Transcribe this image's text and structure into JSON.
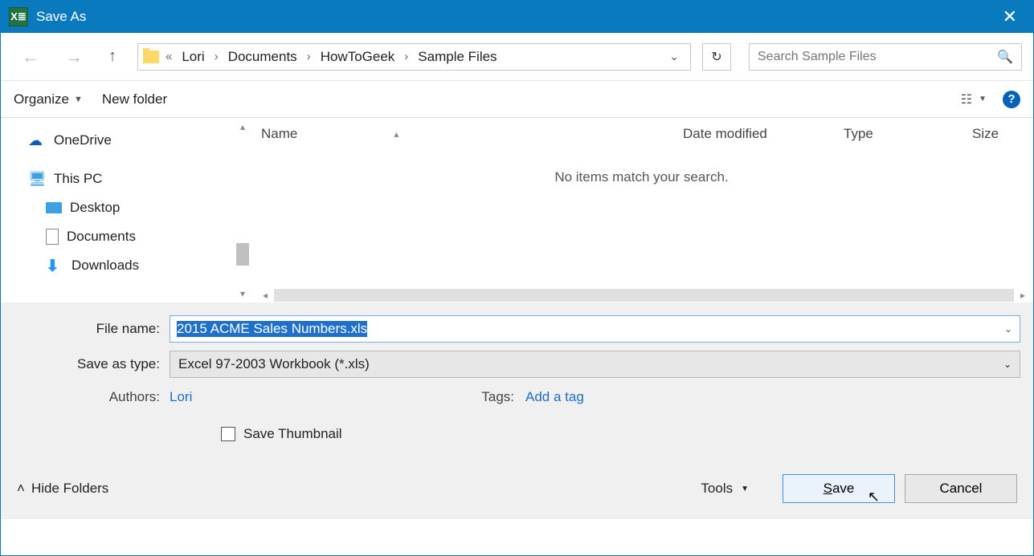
{
  "titlebar": {
    "title": "Save As",
    "app_icon_label": "X≣"
  },
  "nav": {
    "breadcrumbs_prefix": "«",
    "crumbs": [
      "Lori",
      "Documents",
      "HowToGeek",
      "Sample Files"
    ]
  },
  "search": {
    "placeholder": "Search Sample Files"
  },
  "toolbar": {
    "organize": "Organize",
    "new_folder": "New folder"
  },
  "tree": {
    "items": [
      {
        "icon": "cloud",
        "label": "OneDrive",
        "child": false
      },
      {
        "icon": "pc",
        "label": "This PC",
        "child": false
      },
      {
        "icon": "desk",
        "label": "Desktop",
        "child": true
      },
      {
        "icon": "doc",
        "label": "Documents",
        "child": true
      },
      {
        "icon": "down",
        "label": "Downloads",
        "child": true
      }
    ]
  },
  "list": {
    "columns": {
      "name": "Name",
      "date": "Date modified",
      "type": "Type",
      "size": "Size"
    },
    "empty_text": "No items match your search."
  },
  "form": {
    "file_name_label": "File name:",
    "file_name_value": "2015 ACME Sales Numbers.xls",
    "save_type_label": "Save as type:",
    "save_type_value": "Excel 97-2003 Workbook (*.xls)",
    "authors_label": "Authors:",
    "authors_value": "Lori",
    "tags_label": "Tags:",
    "tags_value": "Add a tag",
    "save_thumbnail": "Save Thumbnail"
  },
  "footer": {
    "hide_folders": "Hide Folders",
    "tools": "Tools",
    "save": "Save",
    "cancel": "Cancel"
  }
}
